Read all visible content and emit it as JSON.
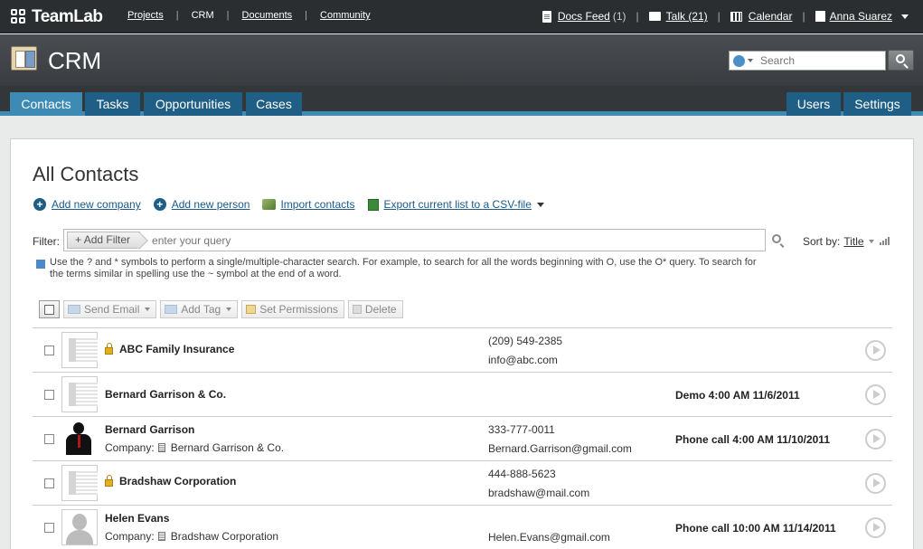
{
  "topbar": {
    "logo": "TeamLab",
    "nav": [
      {
        "label": "Projects",
        "current": false
      },
      {
        "label": "CRM",
        "current": true
      },
      {
        "label": "Documents",
        "current": false
      },
      {
        "label": "Community",
        "current": false
      }
    ],
    "docs_feed": {
      "label": "Docs Feed",
      "count": "(1)"
    },
    "talk": {
      "label": "Talk (21)"
    },
    "calendar": {
      "label": "Calendar"
    },
    "user": {
      "name": "Anna Suarez"
    }
  },
  "module": {
    "title": "CRM",
    "search_placeholder": "Search"
  },
  "tabs": {
    "left": [
      "Contacts",
      "Tasks",
      "Opportunities",
      "Cases"
    ],
    "right": [
      "Users",
      "Settings"
    ],
    "active": "Contacts"
  },
  "main": {
    "title": "All Contacts",
    "actions": {
      "add_company": "Add new company",
      "add_person": "Add new person",
      "import": "Import contacts",
      "export": "Export current list to a CSV-file"
    },
    "filter": {
      "label": "Filter:",
      "add_filter": "Add Filter",
      "placeholder": "enter your query"
    },
    "sort": {
      "label": "Sort by:",
      "value": "Title"
    },
    "hint_line1": "Use the ? and * symbols to perform a single/multiple-character search. For example, to search for all the words beginning with O, use the O* query. To search for",
    "hint_line2": "the terms similar in spelling use the ~ symbol at the end of a word.",
    "toolbar": {
      "send_email": "Send Email",
      "add_tag": "Add Tag",
      "set_permissions": "Set Permissions",
      "delete": "Delete"
    }
  },
  "contacts": [
    {
      "name": "ABC Family Insurance",
      "type": "company",
      "locked": true,
      "company_label": "",
      "company": "",
      "phone": "(209) 549-2385",
      "email": "info@abc.com",
      "task": ""
    },
    {
      "name": "Bernard Garrison & Co.",
      "type": "company",
      "locked": false,
      "company_label": "",
      "company": "",
      "phone": "",
      "email": "",
      "task": "Demo 4:00 AM 11/6/2011"
    },
    {
      "name": "Bernard Garrison",
      "type": "photo",
      "locked": false,
      "company_label": "Company:",
      "company": "Bernard Garrison & Co.",
      "phone": "333-777-0011",
      "email": "Bernard.Garrison@gmail.com",
      "task": "Phone call 4:00 AM 11/10/2011"
    },
    {
      "name": "Bradshaw Corporation",
      "type": "company",
      "locked": true,
      "company_label": "",
      "company": "",
      "phone": "444-888-5623",
      "email": "bradshaw@mail.com",
      "task": ""
    },
    {
      "name": "Helen Evans",
      "type": "person",
      "locked": false,
      "company_label": "Company:",
      "company": "Bradshaw Corporation",
      "phone": "",
      "email": "Helen.Evans@gmail.com",
      "task": "Phone call 10:00 AM 11/14/2011"
    }
  ]
}
